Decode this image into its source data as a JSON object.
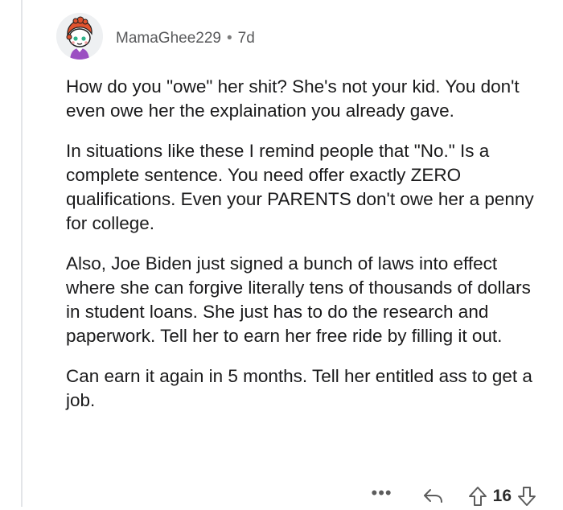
{
  "comment": {
    "author": "MamaGhee229",
    "separator": "•",
    "age": "7d",
    "paragraphs": [
      "How do you \"owe\" her shit? She's not your kid. You don't even owe her the explaination you already gave.",
      "In situations like these I remind people that \"No.\" Is a complete sentence. You need offer exactly ZERO qualifications. Even your PARENTS don't owe her a penny for college.",
      "Also, Joe Biden just signed a bunch of laws into effect where she can forgive literally tens of thousands of dollars in student loans. She just has to do the research and paperwork. Tell her to earn her free ride by filling it out.",
      "Can earn it again in 5 months. Tell her entitled ass to get a job."
    ],
    "actions": {
      "more": "•••",
      "score": "16"
    }
  },
  "icons": {
    "avatar": "snoo-avatar-icon",
    "more": "more-options-icon",
    "reply": "reply-icon",
    "upvote": "upvote-icon",
    "downvote": "downvote-icon"
  },
  "colors": {
    "text": "#1a1a1b",
    "meta": "#58595b",
    "thread_line": "#e3e5e8",
    "avatar_bg": "#eef0f2",
    "hair": "#e0532f",
    "shirt": "#9b4fc2"
  }
}
